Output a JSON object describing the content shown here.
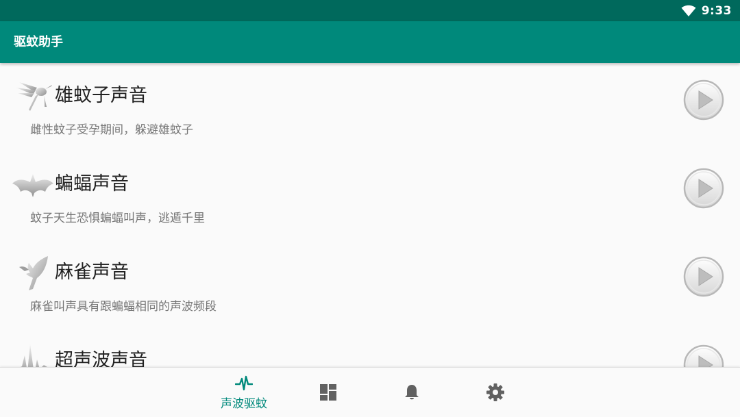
{
  "status_bar": {
    "time": "9:33",
    "wifi_icon": "wifi-icon"
  },
  "app_bar": {
    "title": "驱蚊助手"
  },
  "items": [
    {
      "title": "雄蚊子声音",
      "desc": "雌性蚊子受孕期间，躲避雄蚊子",
      "icon": "mosquito-icon"
    },
    {
      "title": "蝙蝠声音",
      "desc": "蚊子天生恐惧蝙蝠叫声，逃遁千里",
      "icon": "bat-icon"
    },
    {
      "title": "麻雀声音",
      "desc": "麻雀叫声具有跟蝙蝠相同的声波频段",
      "icon": "sparrow-icon"
    },
    {
      "title": "超声波声音",
      "desc": "",
      "icon": "waveform-icon"
    }
  ],
  "bottom_nav": {
    "tabs": [
      {
        "label": "声波驱蚊",
        "icon": "pulse-icon",
        "active": true
      },
      {
        "label": "",
        "icon": "dashboard-icon",
        "active": false
      },
      {
        "label": "",
        "icon": "bell-icon",
        "active": false
      },
      {
        "label": "",
        "icon": "gear-icon",
        "active": false
      }
    ]
  },
  "colors": {
    "status_bar": "#00695c",
    "app_bar": "#00897b",
    "accent": "#00897b",
    "icon_gray": "#616161"
  }
}
